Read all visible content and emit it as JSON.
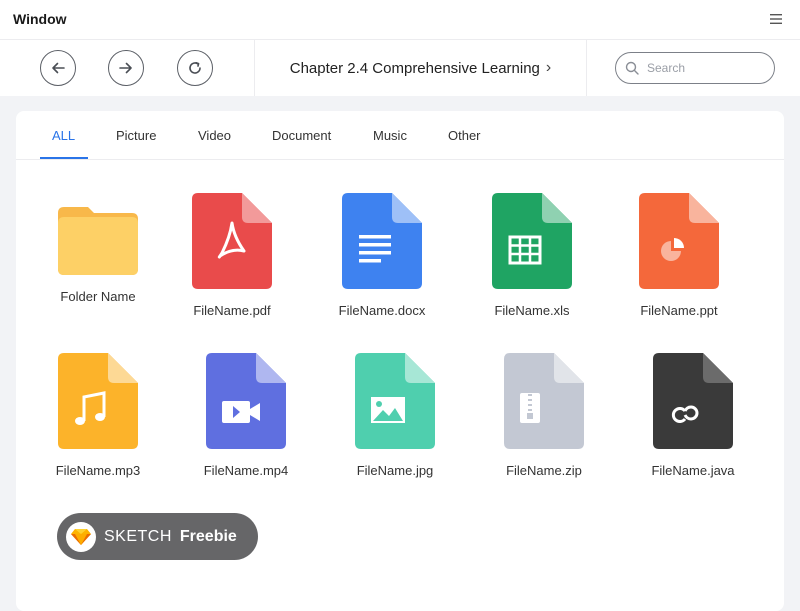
{
  "window": {
    "title": "Window",
    "menu_icon": "hamburger-menu-icon"
  },
  "toolbar": {
    "back_icon": "arrow-left-icon",
    "forward_icon": "arrow-right-icon",
    "refresh_icon": "refresh-icon",
    "breadcrumb": "Chapter 2.4 Comprehensive Learning",
    "breadcrumb_chevron": "›",
    "search": {
      "placeholder": "Search",
      "value": ""
    }
  },
  "tabs": [
    {
      "label": "ALL",
      "active": true
    },
    {
      "label": "Picture"
    },
    {
      "label": "Video"
    },
    {
      "label": "Document"
    },
    {
      "label": "Music"
    },
    {
      "label": "Other"
    }
  ],
  "files": [
    {
      "name": "Folder Name",
      "type": "folder",
      "color": "#fdd066"
    },
    {
      "name": "FileName.pdf",
      "type": "pdf",
      "color": "#e94b4b"
    },
    {
      "name": "FileName.docx",
      "type": "docx",
      "color": "#3e82f0"
    },
    {
      "name": "FileName.xls",
      "type": "xls",
      "color": "#1fa463"
    },
    {
      "name": "FileName.ppt",
      "type": "ppt",
      "color": "#f4683b"
    },
    {
      "name": "FileName.mp3",
      "type": "mp3",
      "color": "#fcb32a"
    },
    {
      "name": "FileName.mp4",
      "type": "mp4",
      "color": "#5f6fe0"
    },
    {
      "name": "FileName.jpg",
      "type": "jpg",
      "color": "#4fcfae"
    },
    {
      "name": "FileName.zip",
      "type": "zip",
      "color": "#c3c8d3"
    },
    {
      "name": "FileName.java",
      "type": "java",
      "color": "#3a3a3a"
    }
  ],
  "badge": {
    "brand": "SKETCH",
    "label": "Freebie",
    "logo_icon": "sketch-diamond-icon"
  },
  "colors": {
    "accent": "#2a74e8",
    "background": "#f2f3f6"
  }
}
